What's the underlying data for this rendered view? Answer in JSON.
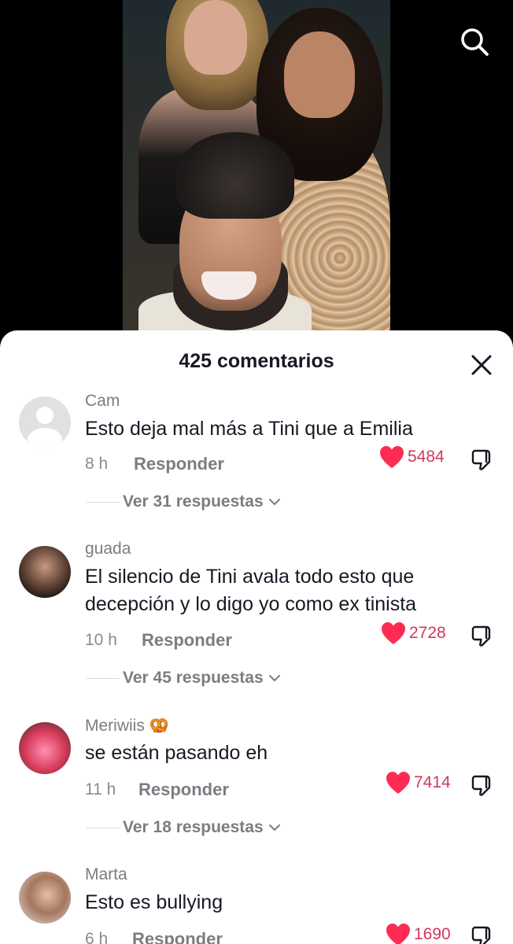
{
  "header": {
    "comments_count_title": "425 comentarios"
  },
  "icons": {
    "search": "search-icon",
    "close": "close-icon",
    "like": "heart-icon",
    "dislike": "thumbs-down-icon",
    "chevron": "chevron-down-icon"
  },
  "colors": {
    "heart": "#fe2c55",
    "like_count": "#d0395b",
    "sheet_bg": "#ffffff"
  },
  "comments": [
    {
      "username": "Cam",
      "emoji": "",
      "text": "Esto deja mal más a Tini que a Emilia",
      "time": "8 h",
      "reply_label": "Responder",
      "likes": "5484",
      "view_replies": "Ver 31 respuestas"
    },
    {
      "username": "guada",
      "emoji": "",
      "text": "El silencio de Tini avala todo esto que decepción y lo digo yo como ex tinista",
      "time": "10 h",
      "reply_label": "Responder",
      "likes": "2728",
      "view_replies": "Ver 45 respuestas"
    },
    {
      "username": "Meriwiis",
      "emoji": "🥨",
      "text": "se están pasando eh",
      "time": "11 h",
      "reply_label": "Responder",
      "likes": "7414",
      "view_replies": "Ver 18 respuestas"
    },
    {
      "username": "Marta",
      "emoji": "",
      "text": "Esto es bullying",
      "time": "6 h",
      "reply_label": "Responder",
      "likes": "1690",
      "view_replies": ""
    }
  ]
}
